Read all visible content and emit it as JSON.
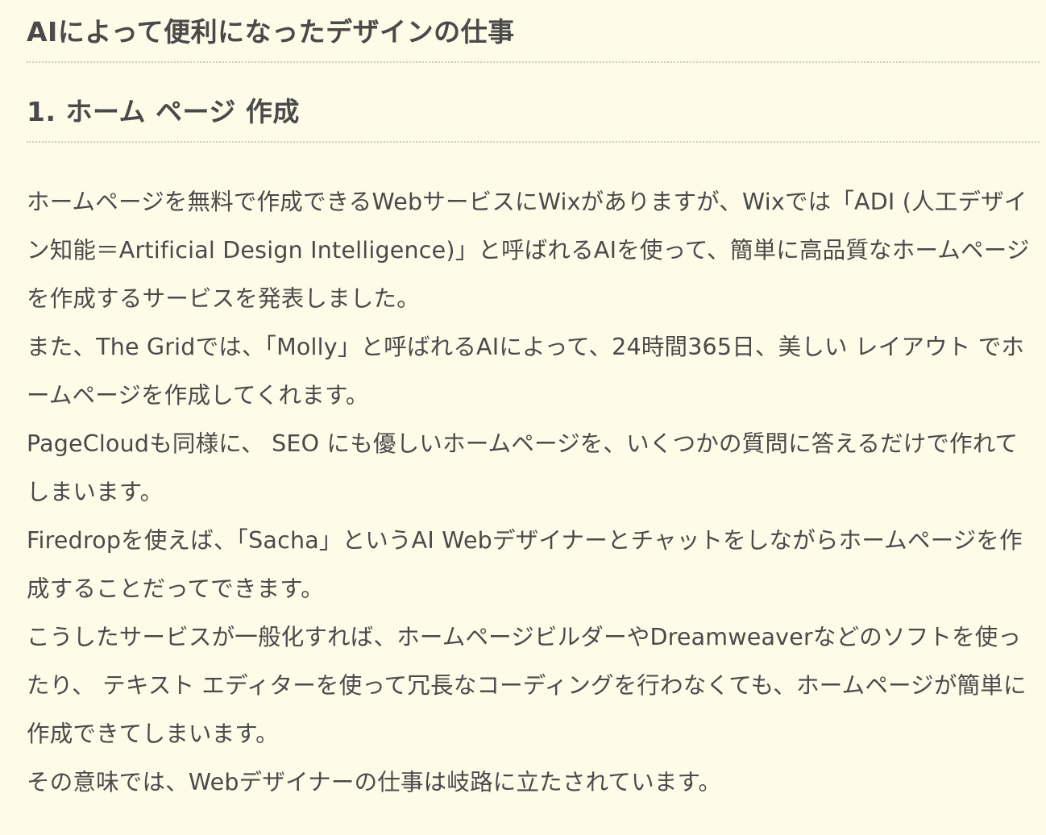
{
  "article": {
    "title": "AIによって便利になったデザインの仕事",
    "section_heading": "1. ホーム ページ 作成",
    "paragraphs": [
      "ホームページを無料で作成できるWebサービスにWixがありますが、Wixでは「ADI (人工デザイン知能＝Artificial Design Intelligence)」と呼ばれるAIを使って、簡単に高品質なホームページを作成するサービスを発表しました。",
      "また、The Gridでは、「Molly」と呼ばれるAIによって、24時間365日、美しい レイアウト でホームページを作成してくれます。",
      "PageCloudも同様に、 SEO にも優しいホームページを、いくつかの質問に答えるだけで作れてしまいます。",
      "Firedropを使えば、「Sacha」というAI Webデザイナーとチャットをしながらホームページを作成することだってできます。",
      "こうしたサービスが一般化すれば、ホームページビルダーやDreamweaverなどのソフトを使ったり、 テキスト エディターを使って冗長なコーディングを行わなくても、ホームページが簡単に作成できてしまいます。",
      "その意味では、Webデザイナーの仕事は岐路に立たされています。"
    ]
  },
  "colors": {
    "background": "#fefce8",
    "text": "#4a4a4a",
    "divider": "#cfcbbf"
  }
}
